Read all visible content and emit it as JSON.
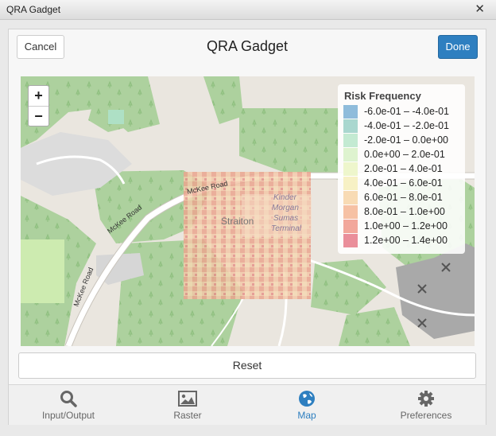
{
  "window": {
    "title": "QRA Gadget",
    "close_icon": "close-icon"
  },
  "header": {
    "cancel_label": "Cancel",
    "title": "QRA Gadget",
    "done_label": "Done"
  },
  "map": {
    "zoom_in": "+",
    "zoom_out": "−",
    "labels": {
      "road1": "McKee Road",
      "road2": "McKee Road",
      "road3": "McKee Road",
      "place": "Straiton",
      "terminal1": "Kinder",
      "terminal2": "Morgan",
      "terminal3": "Sumas",
      "terminal4": "Terminal"
    },
    "legend": {
      "title": "Risk Frequency",
      "items": [
        {
          "label": "-6.0e-01 – -4.0e-01",
          "color": "#8fbcdb"
        },
        {
          "label": "-4.0e-01 – -2.0e-01",
          "color": "#a9d7cf"
        },
        {
          "label": "-2.0e-01 – 0.0e+00",
          "color": "#c3ead2"
        },
        {
          "label": "0.0e+00 – 2.0e-01",
          "color": "#def3cf"
        },
        {
          "label": "2.0e-01 – 4.0e-01",
          "color": "#eef6cc"
        },
        {
          "label": "4.0e-01 – 6.0e-01",
          "color": "#f7f1c5"
        },
        {
          "label": "6.0e-01 – 8.0e-01",
          "color": "#f8dbb4"
        },
        {
          "label": "8.0e-01 – 1.0e+00",
          "color": "#f6c1a4"
        },
        {
          "label": "1.0e+00 – 1.2e+00",
          "color": "#f2a79b"
        },
        {
          "label": "1.2e+00 – 1.4e+00",
          "color": "#ea8e9a"
        }
      ]
    }
  },
  "reset_label": "Reset",
  "tabs": [
    {
      "label": "Input/Output",
      "icon": "search-icon",
      "active": false
    },
    {
      "label": "Raster",
      "icon": "image-icon",
      "active": false
    },
    {
      "label": "Map",
      "icon": "globe-icon",
      "active": true
    },
    {
      "label": "Preferences",
      "icon": "gear-icon",
      "active": false
    }
  ],
  "colors": {
    "accent": "#2e7fc0",
    "forest": "#add19e",
    "road": "#ffffff"
  }
}
